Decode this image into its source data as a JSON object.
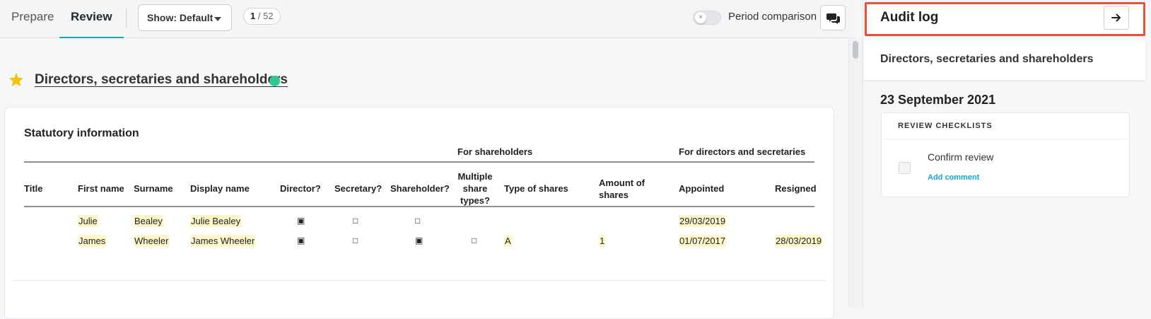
{
  "topbar": {
    "tabs": [
      {
        "label": "Prepare",
        "active": false
      },
      {
        "label": "Review",
        "active": true
      }
    ],
    "show_select": "Show: Default",
    "page_counter": {
      "current": "1",
      "total": "/ 52"
    },
    "period_comparison_label": "Period comparison",
    "period_comparison_on": false,
    "icons": {
      "comments": "comments-icon",
      "toggle_off": "×"
    }
  },
  "section": {
    "title": "Directors, secretaries and shareholders",
    "status_color": "#2ec98d",
    "starred": true
  },
  "statutory": {
    "title": "Statutory information",
    "group_headers": [
      "For shareholders",
      "For directors and secretaries"
    ],
    "columns": [
      "Title",
      "First name",
      "Surname",
      "Display name",
      "Director?",
      "Secretary?",
      "Shareholder?",
      "Multiple share types?",
      "Type of shares",
      "Amount of shares",
      "Appointed",
      "Resigned"
    ],
    "rows": [
      {
        "title": "",
        "first_name": "Julie",
        "surname": "Bealey",
        "display_name": "Julie Bealey",
        "director": "▣",
        "secretary": "□",
        "shareholder": "□",
        "multiple": "",
        "type_of_shares": "",
        "amount": "",
        "appointed": "29/03/2019",
        "resigned": ""
      },
      {
        "title": "",
        "first_name": "James",
        "surname": "Wheeler",
        "display_name": "James Wheeler",
        "director": "▣",
        "secretary": "□",
        "shareholder": "▣",
        "multiple": "□",
        "type_of_shares": "A",
        "amount": "1",
        "appointed": "01/07/2017",
        "resigned": "28/03/2019"
      }
    ]
  },
  "panel": {
    "title": "Audit log",
    "subtitle": "Directors, secretaries and shareholders",
    "date": "23 September 2021",
    "checklist_header": "REVIEW CHECKLISTS",
    "checklist_item": "Confirm review",
    "add_comment": "Add comment",
    "accent_color": "#e8503a",
    "link_color": "#1aa3c6"
  }
}
